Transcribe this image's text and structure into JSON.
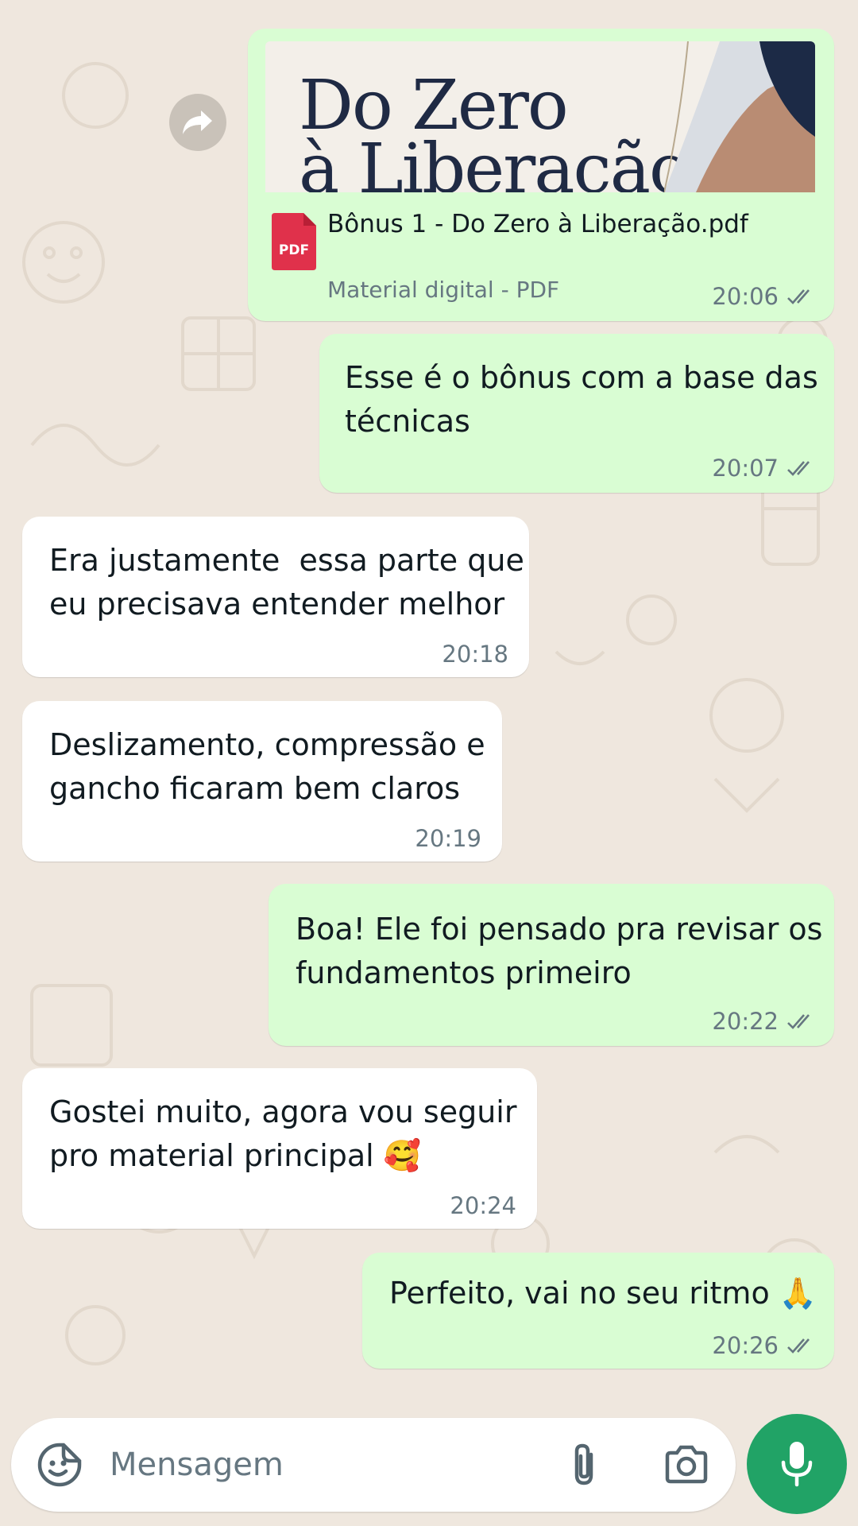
{
  "colors": {
    "outgoing_bubble": "#d9fdd3",
    "incoming_bubble": "#ffffff",
    "read_ticks": "#667781",
    "mic_button": "#21a366",
    "pdf_icon": "#e0314b",
    "wallpaper": "#efe7de"
  },
  "document": {
    "preview_line1": "Do Zero",
    "preview_line2": "à Liberação",
    "file_name": "Bônus 1 - Do Zero à Liberação.pdf",
    "file_type_badge": "PDF",
    "subtitle": "Material digital - PDF",
    "time": "20:06",
    "status": "read"
  },
  "messages": [
    {
      "direction": "out",
      "text": "Esse é o bônus com a base das\ntécnicas",
      "time": "20:07",
      "status": "read"
    },
    {
      "direction": "in",
      "text": "Era justamente  essa parte que\neu precisava entender melhor",
      "time": "20:18"
    },
    {
      "direction": "in",
      "text": "Deslizamento, compressão e\ngancho ficaram bem claros",
      "time": "20:19"
    },
    {
      "direction": "out",
      "text": "Boa! Ele foi pensado pra revisar os\nfundamentos primeiro",
      "time": "20:22",
      "status": "read"
    },
    {
      "direction": "in",
      "text": "Gostei muito, agora vou seguir\npro material principal 🥰",
      "time": "20:24"
    },
    {
      "direction": "out",
      "text": "Perfeito, vai no seu ritmo 🙏",
      "time": "20:26",
      "status": "read"
    }
  ],
  "composer": {
    "placeholder": "Mensagem",
    "icons": [
      "sticker-icon",
      "attach-icon",
      "camera-icon",
      "mic-icon"
    ]
  }
}
